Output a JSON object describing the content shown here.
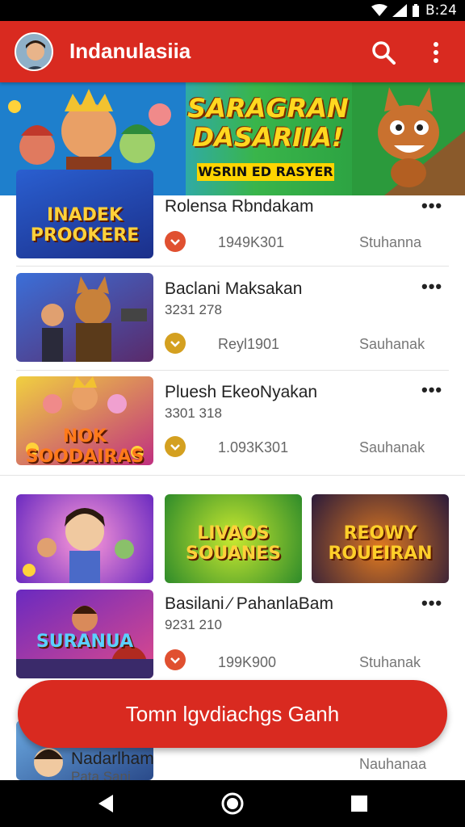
{
  "status": {
    "time": "B:24"
  },
  "appbar": {
    "title": "Indanulasiia",
    "search_icon": "search-icon",
    "more_icon": "more-vert-icon",
    "color": "#d92a20"
  },
  "banner": {
    "title": "SARAGRAN DASARIIA!",
    "subtitle": "WSRIN ED RASYER"
  },
  "items": [
    {
      "name": "Rolensa Rbndakam",
      "sub": "",
      "count": "1949K301",
      "cat": "Stuhanna",
      "dot_color": "#e05030",
      "thumb_text": "INADEK PROOKERE"
    },
    {
      "name": "Baclani Maksakan",
      "sub": "3231 278",
      "count": "Reyl1901",
      "cat": "Sauhanak",
      "dot_color": "#d4a020",
      "thumb_text": ""
    },
    {
      "name": "Pluesh EkeoNyakan",
      "sub": "3301 318",
      "count": "1.093K301",
      "cat": "Sauhanak",
      "dot_color": "#d4a020",
      "thumb_text": "NOK SOODAIRAS"
    },
    {
      "name": "Basilani ⁄ PahanlaBam",
      "sub": "9231 210",
      "count": "199K900",
      "cat": "Stuhanak",
      "dot_color": "#e05030",
      "thumb_text": "SURANUA"
    },
    {
      "name": "Nadarlham",
      "sub": "Pata Sani",
      "count": "",
      "cat": "Nauhanaa",
      "dot_color": "",
      "thumb_text": ""
    }
  ],
  "grid": [
    {
      "label": ""
    },
    {
      "label": "LIVAOS SOUANES"
    },
    {
      "label": "REOWY ROUEIRAN"
    }
  ],
  "fab": {
    "label": "Tomn lgvdiachgs Ganh"
  },
  "nav": {
    "back": "back-icon",
    "home": "home-icon",
    "recents": "recents-icon"
  }
}
